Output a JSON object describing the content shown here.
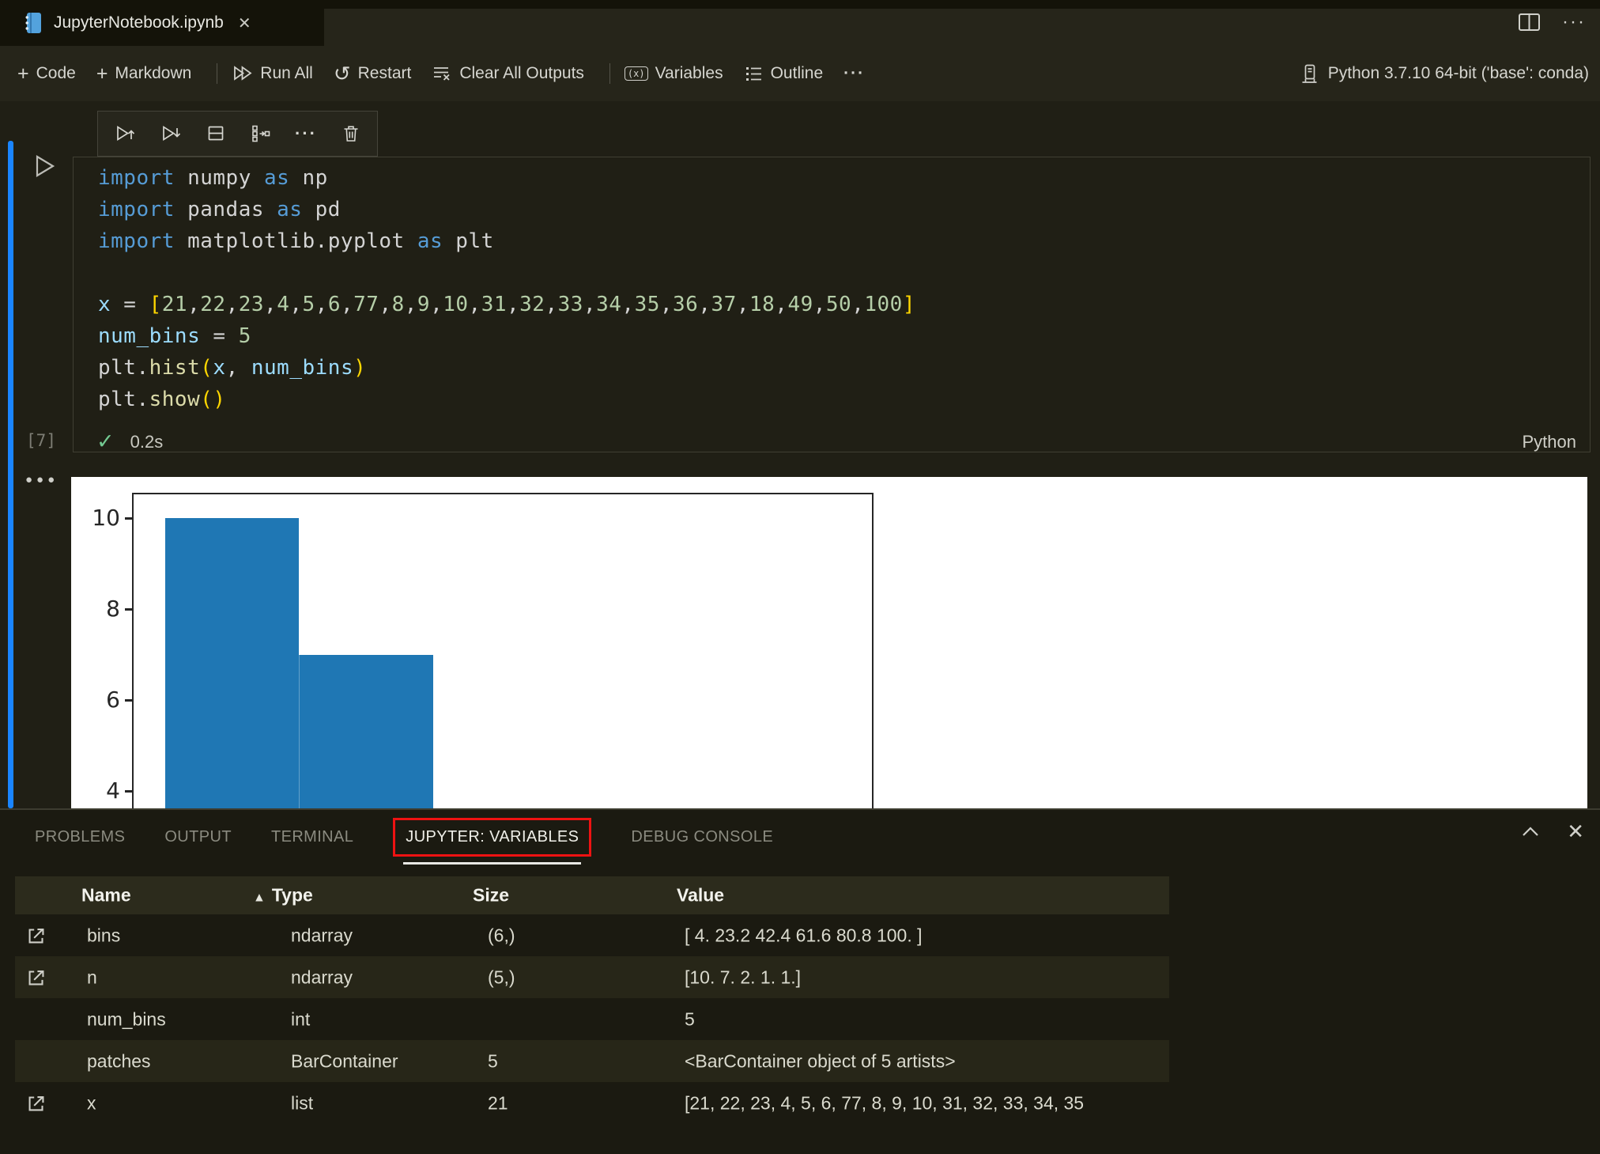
{
  "colors": {
    "focus_blue": "#1a85ff",
    "annotation_red": "#ee1212",
    "histogram_bar": "#1f77b4"
  },
  "titlebar": {
    "tab_title": "JupyterNotebook.ipynb"
  },
  "toolbar": {
    "code": "Code",
    "markdown": "Markdown",
    "run_all": "Run All",
    "restart": "Restart",
    "clear_all_outputs": "Clear All Outputs",
    "variables": "Variables",
    "outline": "Outline",
    "more": "···",
    "kernel": "Python 3.7.10 64-bit ('base': conda)"
  },
  "cell": {
    "execution_count": "[7]",
    "duration": "0.2s",
    "language_label": "Python",
    "code_lines": [
      [
        {
          "t": "import",
          "c": "kw"
        },
        {
          "t": " numpy ",
          "c": "pl"
        },
        {
          "t": "as",
          "c": "kw"
        },
        {
          "t": " np",
          "c": "pl"
        }
      ],
      [
        {
          "t": "import",
          "c": "kw"
        },
        {
          "t": " pandas ",
          "c": "pl"
        },
        {
          "t": "as",
          "c": "kw"
        },
        {
          "t": " pd",
          "c": "pl"
        }
      ],
      [
        {
          "t": "import",
          "c": "kw"
        },
        {
          "t": " matplotlib.pyplot ",
          "c": "pl"
        },
        {
          "t": "as",
          "c": "kw"
        },
        {
          "t": " plt",
          "c": "pl"
        }
      ],
      [],
      [
        {
          "t": "x",
          "c": "var"
        },
        {
          "t": " = ",
          "c": "pl"
        },
        {
          "t": "[",
          "c": "brk"
        },
        {
          "t": "21",
          "c": "num"
        },
        {
          "t": ",",
          "c": "pl"
        },
        {
          "t": "22",
          "c": "num"
        },
        {
          "t": ",",
          "c": "pl"
        },
        {
          "t": "23",
          "c": "num"
        },
        {
          "t": ",",
          "c": "pl"
        },
        {
          "t": "4",
          "c": "num"
        },
        {
          "t": ",",
          "c": "pl"
        },
        {
          "t": "5",
          "c": "num"
        },
        {
          "t": ",",
          "c": "pl"
        },
        {
          "t": "6",
          "c": "num"
        },
        {
          "t": ",",
          "c": "pl"
        },
        {
          "t": "77",
          "c": "num"
        },
        {
          "t": ",",
          "c": "pl"
        },
        {
          "t": "8",
          "c": "num"
        },
        {
          "t": ",",
          "c": "pl"
        },
        {
          "t": "9",
          "c": "num"
        },
        {
          "t": ",",
          "c": "pl"
        },
        {
          "t": "10",
          "c": "num"
        },
        {
          "t": ",",
          "c": "pl"
        },
        {
          "t": "31",
          "c": "num"
        },
        {
          "t": ",",
          "c": "pl"
        },
        {
          "t": "32",
          "c": "num"
        },
        {
          "t": ",",
          "c": "pl"
        },
        {
          "t": "33",
          "c": "num"
        },
        {
          "t": ",",
          "c": "pl"
        },
        {
          "t": "34",
          "c": "num"
        },
        {
          "t": ",",
          "c": "pl"
        },
        {
          "t": "35",
          "c": "num"
        },
        {
          "t": ",",
          "c": "pl"
        },
        {
          "t": "36",
          "c": "num"
        },
        {
          "t": ",",
          "c": "pl"
        },
        {
          "t": "37",
          "c": "num"
        },
        {
          "t": ",",
          "c": "pl"
        },
        {
          "t": "18",
          "c": "num"
        },
        {
          "t": ",",
          "c": "pl"
        },
        {
          "t": "49",
          "c": "num"
        },
        {
          "t": ",",
          "c": "pl"
        },
        {
          "t": "50",
          "c": "num"
        },
        {
          "t": ",",
          "c": "pl"
        },
        {
          "t": "100",
          "c": "num"
        },
        {
          "t": "]",
          "c": "brk"
        }
      ],
      [
        {
          "t": "num_bins",
          "c": "var"
        },
        {
          "t": " = ",
          "c": "pl"
        },
        {
          "t": "5",
          "c": "num"
        }
      ],
      [
        {
          "t": "plt",
          "c": "pl"
        },
        {
          "t": ".",
          "c": "pl"
        },
        {
          "t": "hist",
          "c": "fn"
        },
        {
          "t": "(",
          "c": "brk"
        },
        {
          "t": "x",
          "c": "var"
        },
        {
          "t": ", ",
          "c": "pl"
        },
        {
          "t": "num_bins",
          "c": "var"
        },
        {
          "t": ")",
          "c": "brk"
        }
      ],
      [
        {
          "t": "plt",
          "c": "pl"
        },
        {
          "t": ".",
          "c": "pl"
        },
        {
          "t": "show",
          "c": "fn"
        },
        {
          "t": "(",
          "c": "brk"
        },
        {
          "t": ")",
          "c": "brk"
        }
      ]
    ]
  },
  "output_chart": {
    "type": "bar",
    "subtype": "histogram",
    "bin_edges": [
      4,
      23.2,
      42.4,
      61.6,
      80.8,
      100
    ],
    "counts": [
      10,
      7,
      2,
      1,
      1
    ],
    "visible_yticks": [
      10,
      8,
      6,
      4
    ],
    "xlim": [
      -0.8,
      105.8
    ],
    "bar_color": "#1f77b4",
    "title": "",
    "xlabel": "",
    "ylabel": ""
  },
  "panel": {
    "tabs": [
      {
        "label": "PROBLEMS",
        "active": false
      },
      {
        "label": "OUTPUT",
        "active": false
      },
      {
        "label": "TERMINAL",
        "active": false
      },
      {
        "label": "JUPYTER: VARIABLES",
        "active": true
      },
      {
        "label": "DEBUG CONSOLE",
        "active": false
      }
    ]
  },
  "variables_table": {
    "columns": [
      "Name",
      "Type",
      "Size",
      "Value"
    ],
    "sort_column": "Type",
    "rows": [
      {
        "name": "bins",
        "type": "ndarray",
        "size": "(6,)",
        "value": "[ 4. 23.2 42.4 61.6 80.8 100. ]",
        "viewer": true
      },
      {
        "name": "n",
        "type": "ndarray",
        "size": "(5,)",
        "value": "[10. 7. 2. 1. 1.]",
        "viewer": true
      },
      {
        "name": "num_bins",
        "type": "int",
        "size": "",
        "value": "5",
        "viewer": false
      },
      {
        "name": "patches",
        "type": "BarContainer",
        "size": "5",
        "value": "<BarContainer object of 5 artists>",
        "viewer": false
      },
      {
        "name": "x",
        "type": "list",
        "size": "21",
        "value": "[21, 22, 23, 4, 5, 6, 77, 8, 9, 10, 31, 32, 33, 34, 35",
        "viewer": true
      }
    ]
  }
}
